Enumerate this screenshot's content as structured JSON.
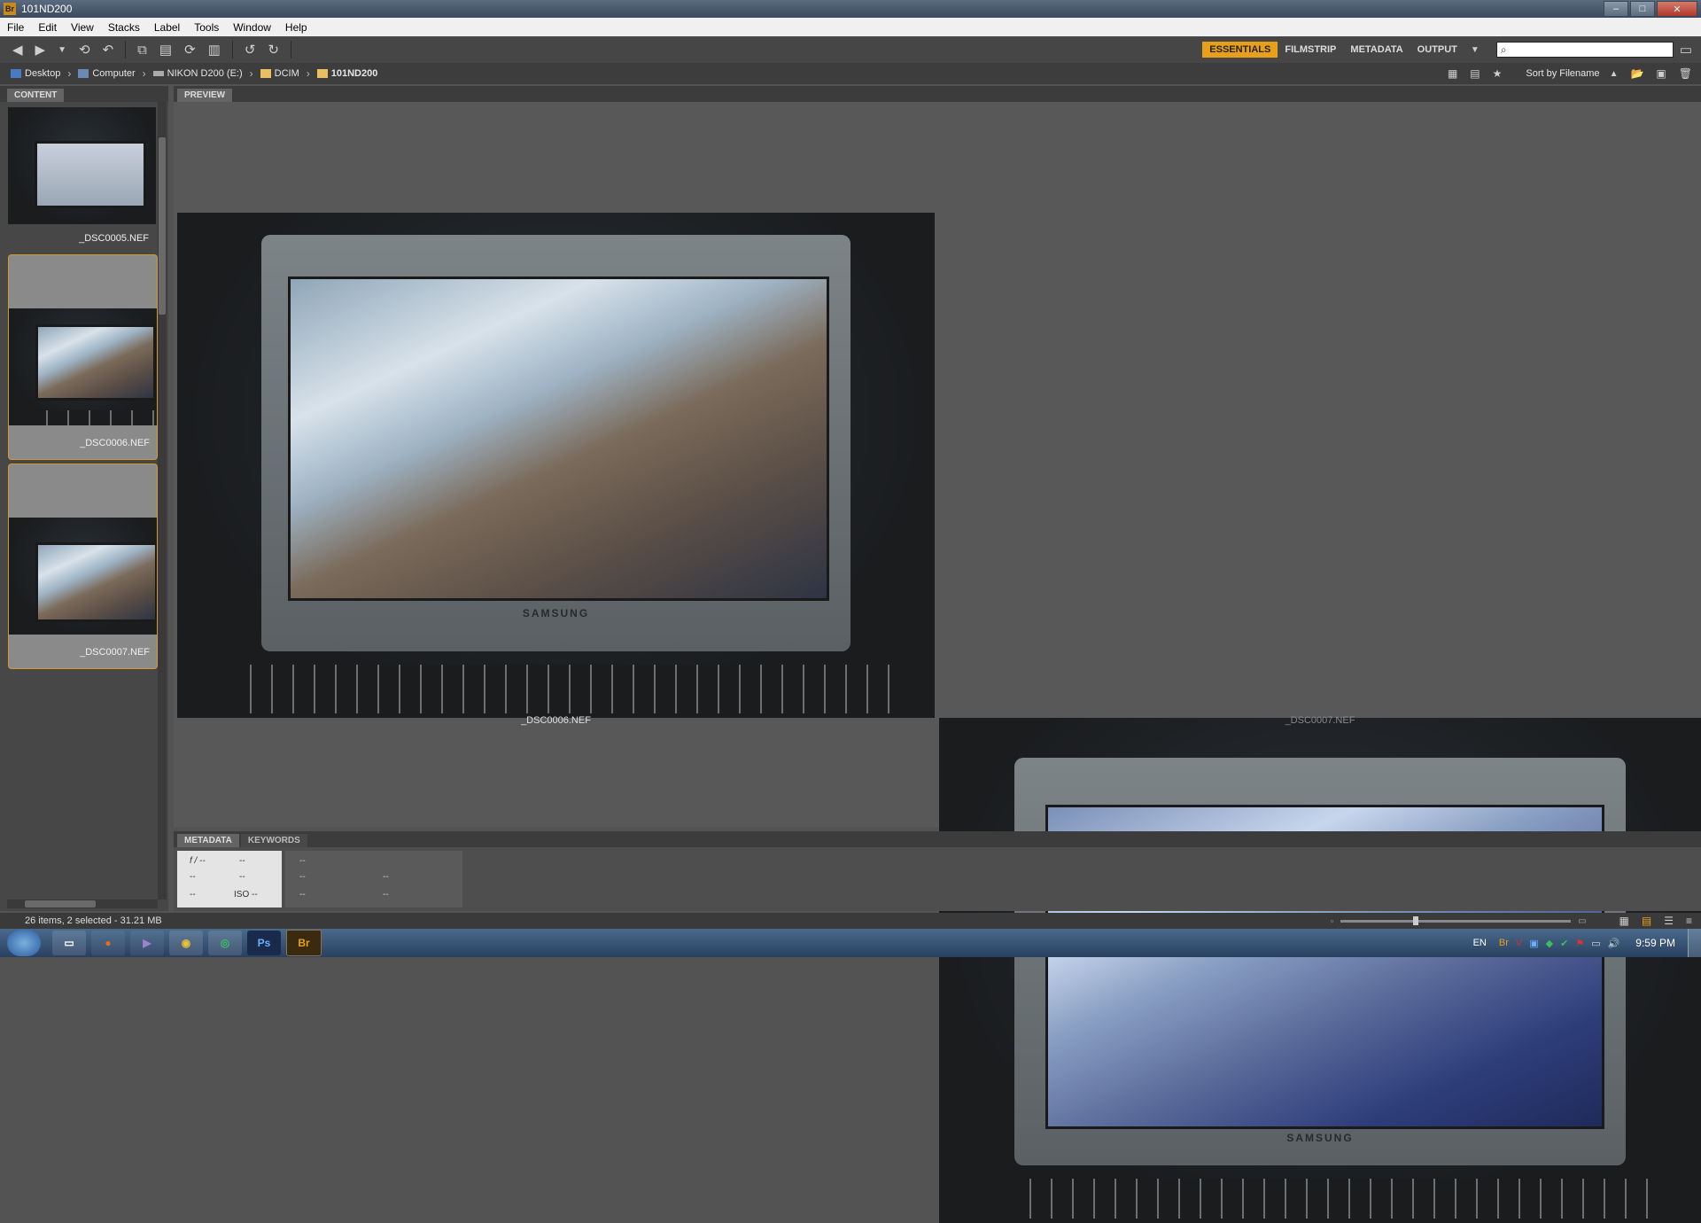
{
  "window": {
    "title": "101ND200",
    "app_icon": "Br"
  },
  "menu": [
    "File",
    "Edit",
    "View",
    "Stacks",
    "Label",
    "Tools",
    "Window",
    "Help"
  ],
  "workspaces": [
    "ESSENTIALS",
    "FILMSTRIP",
    "METADATA",
    "OUTPUT"
  ],
  "active_workspace": "ESSENTIALS",
  "search": {
    "placeholder": ""
  },
  "path": [
    "Desktop",
    "Computer",
    "NIKON D200 (E:)",
    "DCIM",
    "101ND200"
  ],
  "sort_label": "Sort by Filename",
  "panels": {
    "content": "CONTENT",
    "preview": "PREVIEW",
    "metadata": "METADATA",
    "keywords": "KEYWORDS"
  },
  "thumbnails": [
    {
      "name": "_DSC0005.NEF",
      "selected": false
    },
    {
      "name": "_DSC0006.NEF",
      "selected": true
    },
    {
      "name": "_DSC0007.NEF",
      "selected": true
    }
  ],
  "previews": [
    {
      "name": "_DSC0006.NEF",
      "brand": "SAMSUNG"
    },
    {
      "name": "_DSC0007.NEF",
      "brand": "SAMSUNG"
    }
  ],
  "metadata_fields": {
    "aperture": "f / --",
    "dash": "--",
    "iso": "ISO --"
  },
  "status": "26 items, 2 selected - 31.21 MB",
  "taskbar": {
    "lang": "EN",
    "time": "9:59 PM"
  },
  "colors": {
    "accent": "#e8a01a",
    "selection_border": "#d29a2a"
  }
}
